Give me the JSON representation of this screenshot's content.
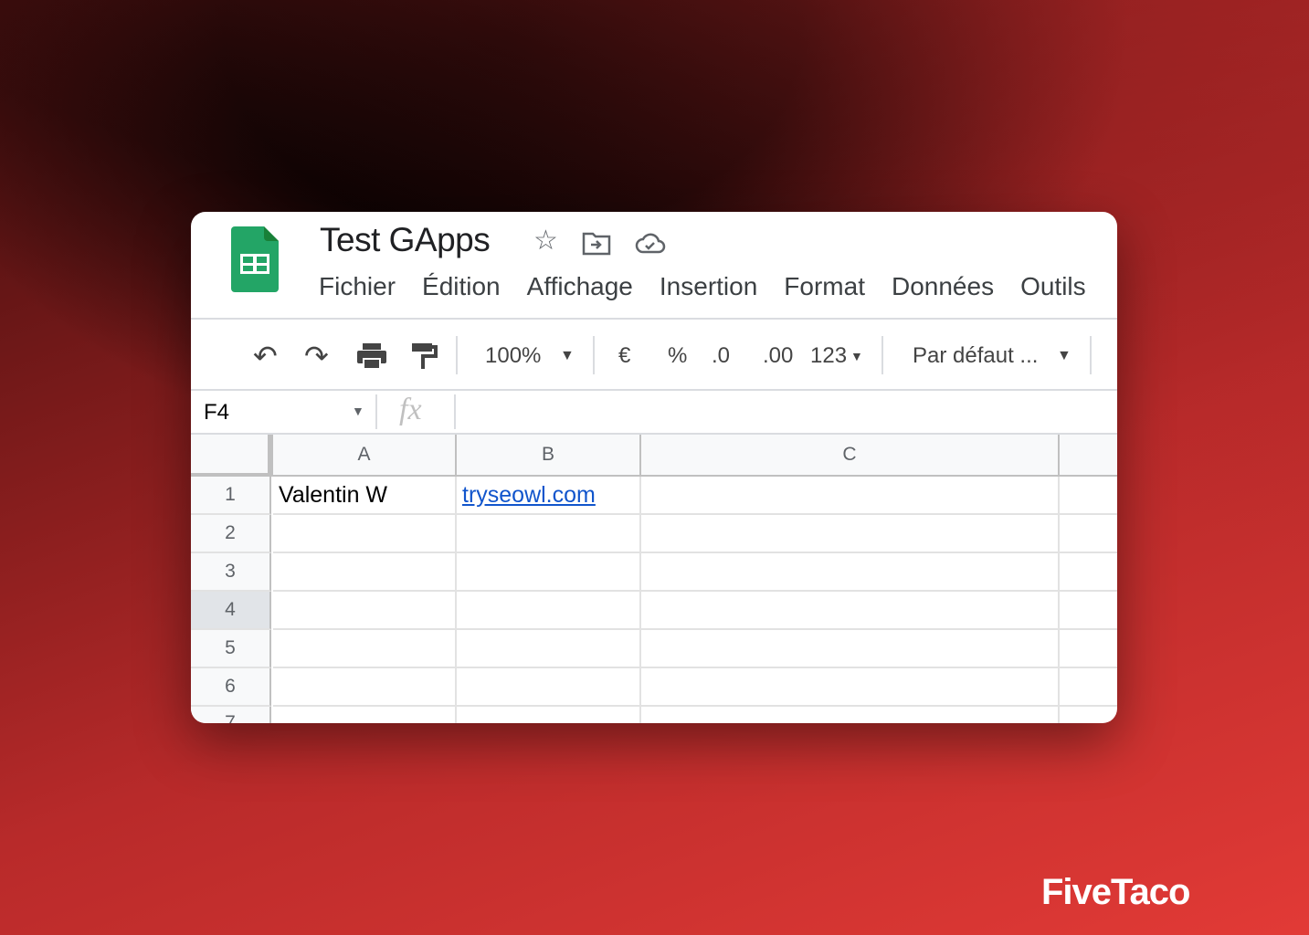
{
  "document": {
    "title": "Test GApps"
  },
  "menu": [
    "Fichier",
    "Édition",
    "Affichage",
    "Insertion",
    "Format",
    "Données",
    "Outils"
  ],
  "toolbar": {
    "zoom": "100%",
    "currency": "€",
    "percent": "%",
    "dec_decrease": ".0",
    "dec_increase": ".00",
    "number_format": "123",
    "font": "Par défaut ..."
  },
  "formula_bar": {
    "cell_ref": "F4",
    "fx": "fx",
    "value": ""
  },
  "columns": [
    "A",
    "B",
    "C"
  ],
  "rows": [
    "1",
    "2",
    "3",
    "4",
    "5",
    "6",
    "7"
  ],
  "cells": {
    "A1": "Valentin W",
    "B1": "tryseowl.com"
  },
  "selected_row": "4",
  "colors": {
    "accent_green": "#34a853",
    "link": "#1155cc",
    "background_red": "#e23a36"
  },
  "brand": "FiveTaco"
}
